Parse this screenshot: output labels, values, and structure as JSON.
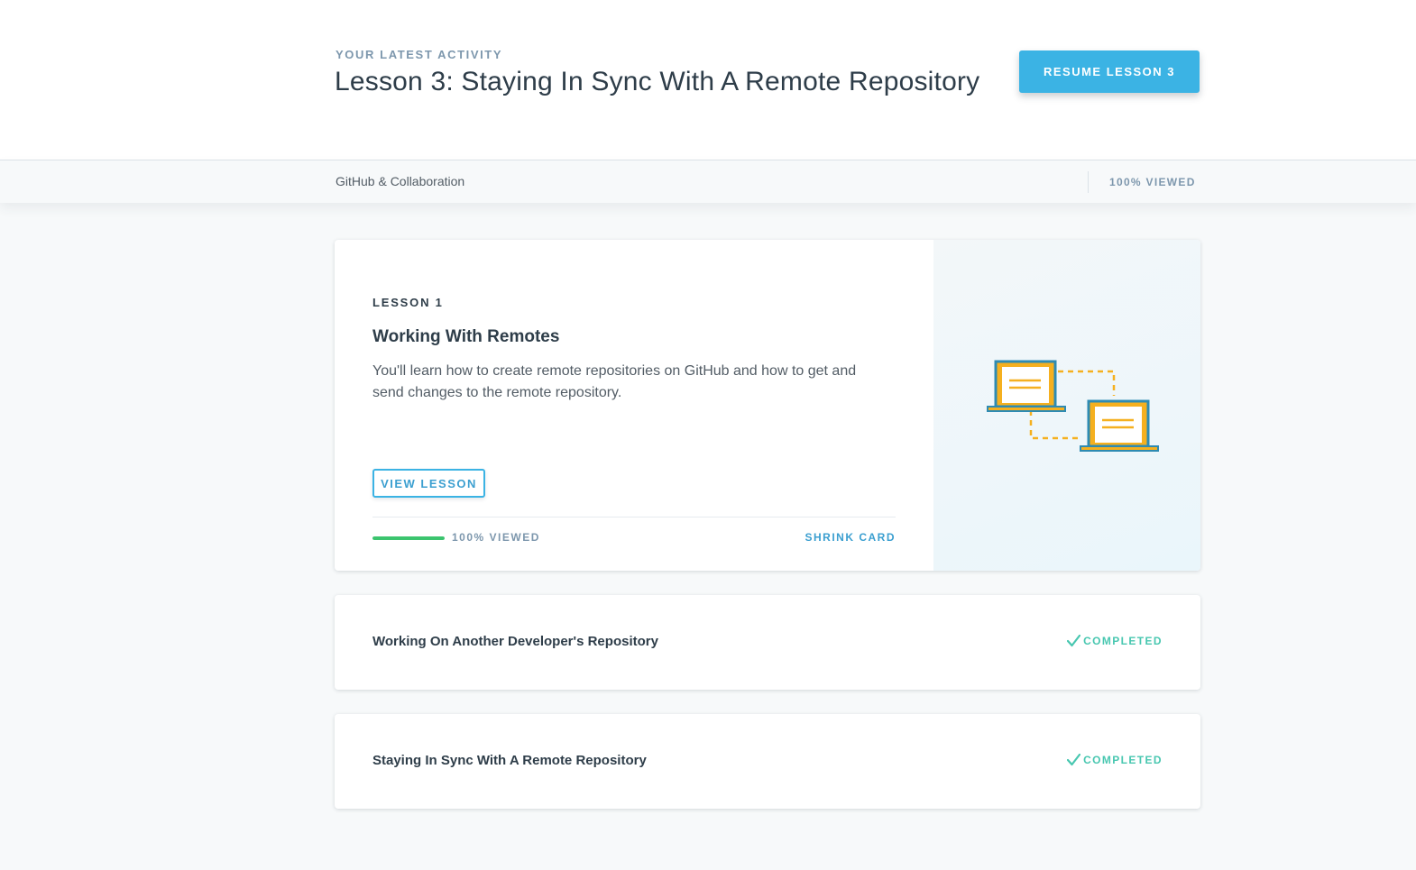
{
  "header": {
    "eyebrow": "YOUR LATEST ACTIVITY",
    "title": "Lesson 3: Staying In Sync With A Remote Repository",
    "resume_button": "RESUME LESSON 3"
  },
  "course_bar": {
    "course_name": "GitHub & Collaboration",
    "progress_text": "100% VIEWED"
  },
  "lesson_card": {
    "eyebrow": "LESSON 1",
    "title": "Working With Remotes",
    "description": "You'll learn how to create remote repositories on GitHub and how to get and send changes to the remote repository.",
    "view_button": "VIEW LESSON",
    "progress_percent": 100,
    "progress_label": "100% VIEWED",
    "shrink_label": "SHRINK CARD",
    "illustration": "two-laptops-sync-icon"
  },
  "collapsed_lessons": [
    {
      "title": "Working On Another Developer's Repository",
      "status": "COMPLETED",
      "status_icon": "checkmark-icon"
    },
    {
      "title": "Staying In Sync With A Remote Repository",
      "status": "COMPLETED",
      "status_icon": "checkmark-icon"
    }
  ],
  "colors": {
    "accent": "#3bb3e4",
    "progress": "#3bc46e",
    "completed": "#48c7b0",
    "illustration_frame": "#2e8bb3",
    "illustration_lines": "#f5b01f"
  }
}
